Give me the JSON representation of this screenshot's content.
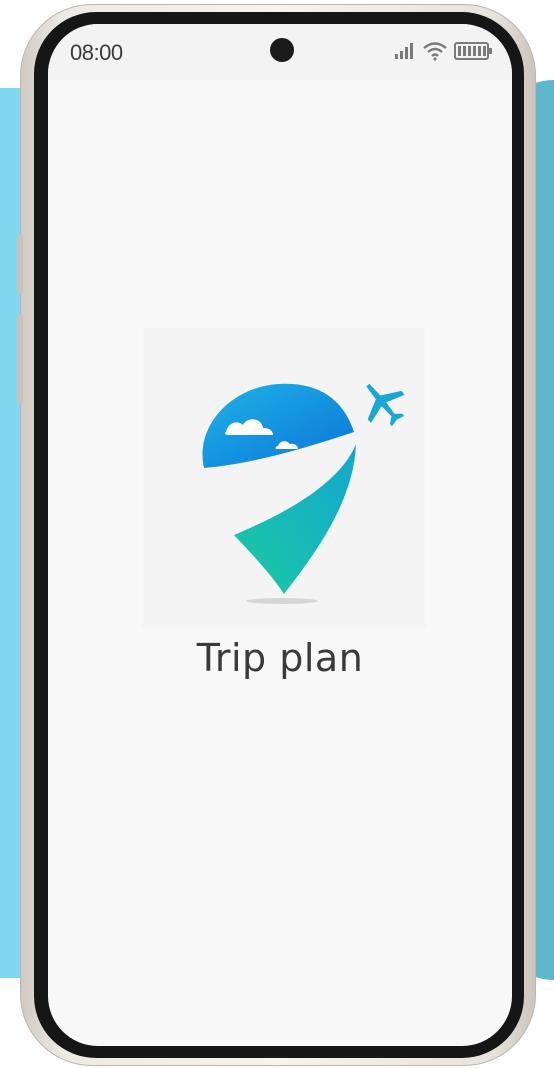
{
  "status_bar": {
    "time": "08:00",
    "icons": [
      "signal-icon",
      "wifi-icon",
      "battery-icon"
    ]
  },
  "splash": {
    "logo_icon": "location-pin-plane-icon",
    "app_name": "Trip plan"
  },
  "colors": {
    "background_left": "#7fd8f0",
    "background_right": "#5fb7cc",
    "screen": "#f8f8f8",
    "logo_blue": "#0a84e0",
    "logo_teal": "#18c7a4",
    "plane": "#1aa7d6"
  }
}
